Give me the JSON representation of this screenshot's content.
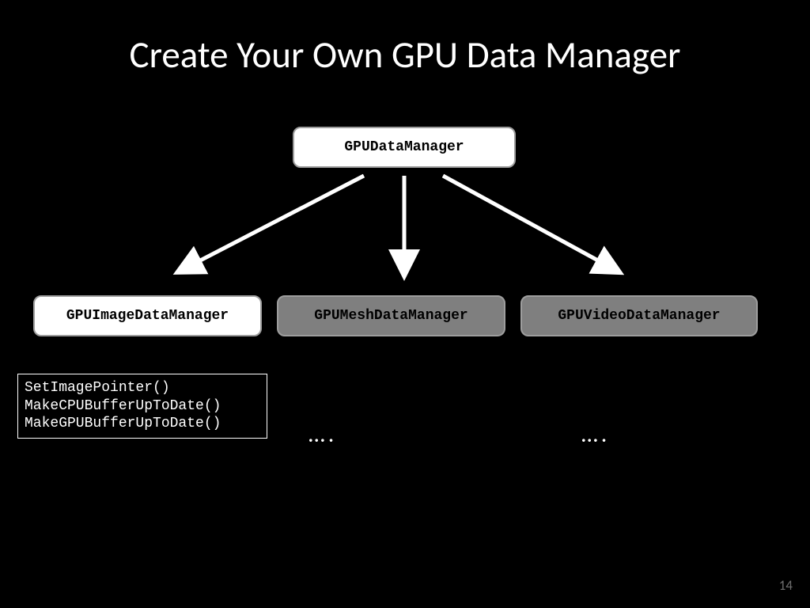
{
  "slide": {
    "title": "Create Your Own GPU Data Manager",
    "page_number": "14"
  },
  "nodes": {
    "root": "GPUDataManager",
    "child_image": "GPUImageDataManager",
    "child_mesh": "GPUMeshDataManager",
    "child_video": "GPUVideoDataManager"
  },
  "code": {
    "image_methods": "SetImagePointer()\nMakeCPUBufferUpToDate()\nMakeGPUBufferUpToDate()"
  },
  "placeholders": {
    "mesh": "….",
    "video": "…."
  }
}
